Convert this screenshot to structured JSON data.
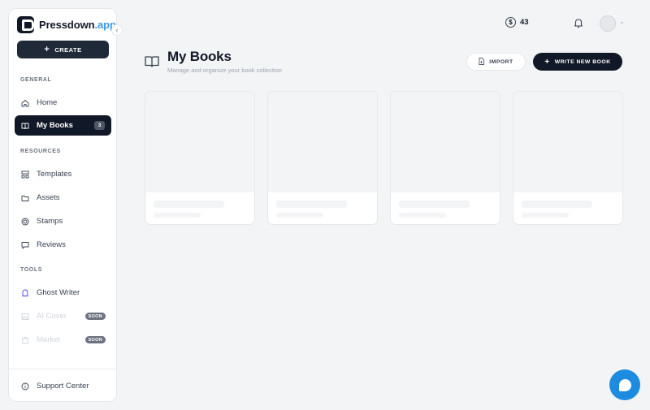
{
  "brand": {
    "name": "Pressdown",
    "suffix": ".app"
  },
  "sidebar": {
    "create_label": "CREATE",
    "sections": {
      "general": "GENERAL",
      "resources": "RESOURCES",
      "tools": "TOOLS"
    },
    "items": {
      "home": "Home",
      "my_books": "My Books",
      "my_books_count": "3",
      "templates": "Templates",
      "assets": "Assets",
      "stamps": "Stamps",
      "reviews": "Reviews",
      "ghost_writer": "Ghost Writer",
      "ai_cover": "AI Cover",
      "market": "Market",
      "soon": "SOON",
      "support_center": "Support Center"
    }
  },
  "topbar": {
    "credits": "43"
  },
  "header": {
    "title": "My Books",
    "subtitle": "Manage and organize your book collection",
    "import_label": "IMPORT",
    "write_label": "WRITE NEW BOOK"
  },
  "colors": {
    "accent": "#3b9ae8",
    "dark": "#111827",
    "chat": "#1d8ce0"
  }
}
